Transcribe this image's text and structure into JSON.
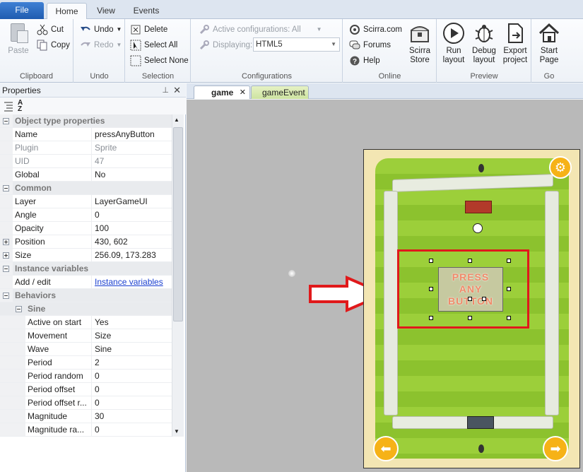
{
  "ribbon_tabs": [
    "File",
    "Home",
    "View",
    "Events"
  ],
  "clipboard": {
    "paste": "Paste",
    "cut": "Cut",
    "copy": "Copy",
    "label": "Clipboard"
  },
  "undo": {
    "undo": "Undo",
    "redo": "Redo",
    "label": "Undo"
  },
  "selection": {
    "delete": "Delete",
    "select_all": "Select All",
    "select_none": "Select None",
    "label": "Selection"
  },
  "configurations": {
    "active": "Active configurations: All",
    "displaying_label": "Displaying:",
    "displaying_value": "HTML5",
    "label": "Configurations"
  },
  "online": {
    "scirra": "Scirra.com",
    "forums": "Forums",
    "help": "Help",
    "store_line1": "Scirra",
    "store_line2": "Store",
    "label": "Online"
  },
  "preview": {
    "run1": "Run",
    "run2": "layout",
    "debug1": "Debug",
    "debug2": "layout",
    "export1": "Export",
    "export2": "project",
    "label": "Preview"
  },
  "go": {
    "start1": "Start",
    "start2": "Page",
    "label": "Go"
  },
  "properties": {
    "title": "Properties",
    "rows": [
      {
        "type": "cat",
        "name": "Object type properties"
      },
      {
        "name": "Name",
        "value": "pressAnyButton"
      },
      {
        "name": "Plugin",
        "value": "Sprite",
        "gray": true
      },
      {
        "name": "UID",
        "value": "47",
        "gray": true
      },
      {
        "name": "Global",
        "value": "No"
      },
      {
        "type": "cat",
        "name": "Common"
      },
      {
        "name": "Layer",
        "value": "LayerGameUI"
      },
      {
        "name": "Angle",
        "value": "0"
      },
      {
        "name": "Opacity",
        "value": "100"
      },
      {
        "name": "Position",
        "value": "430, 602",
        "expand": true
      },
      {
        "name": "Size",
        "value": "256.09, 173.283",
        "expand": true
      },
      {
        "type": "cat",
        "name": "Instance variables"
      },
      {
        "name": "Add / edit",
        "value": "Instance variables",
        "link": true
      },
      {
        "type": "cat",
        "name": "Behaviors"
      },
      {
        "type": "subcat",
        "name": "Sine"
      },
      {
        "name": "Active on start",
        "value": "Yes",
        "sub": true
      },
      {
        "name": "Movement",
        "value": "Size",
        "sub": true
      },
      {
        "name": "Wave",
        "value": "Sine",
        "sub": true
      },
      {
        "name": "Period",
        "value": "2",
        "sub": true
      },
      {
        "name": "Period random",
        "value": "0",
        "sub": true
      },
      {
        "name": "Period offset",
        "value": "0",
        "sub": true
      },
      {
        "name": "Period offset r...",
        "value": "0",
        "sub": true
      },
      {
        "name": "Magnitude",
        "value": "30",
        "sub": true
      },
      {
        "name": "Magnitude ra...",
        "value": "0",
        "sub": true
      }
    ]
  },
  "doc_tabs": [
    "game",
    "gameEvent"
  ],
  "sprite_text": [
    "PRESS",
    "ANY",
    "BUTTON"
  ],
  "colors": {
    "accent": "#1f5cb0",
    "selection": "#e0191b",
    "field": "#9ccf3a"
  }
}
